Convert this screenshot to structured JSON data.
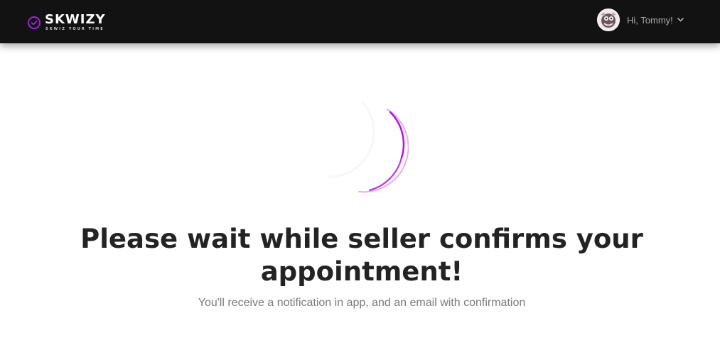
{
  "header": {
    "brand_name": "SKWIZY",
    "brand_tagline": "SKWIZ YOUR TIME",
    "brand_color": "#a11fe0",
    "user_greeting": "Hi, Tommy!",
    "menu_icon": "chevron-down-icon"
  },
  "main": {
    "spinner_color": "#b311e8",
    "title": "Please wait while seller confirms your appointment!",
    "subtitle": "You'll receive a notification in app, and an email with confirmation"
  }
}
